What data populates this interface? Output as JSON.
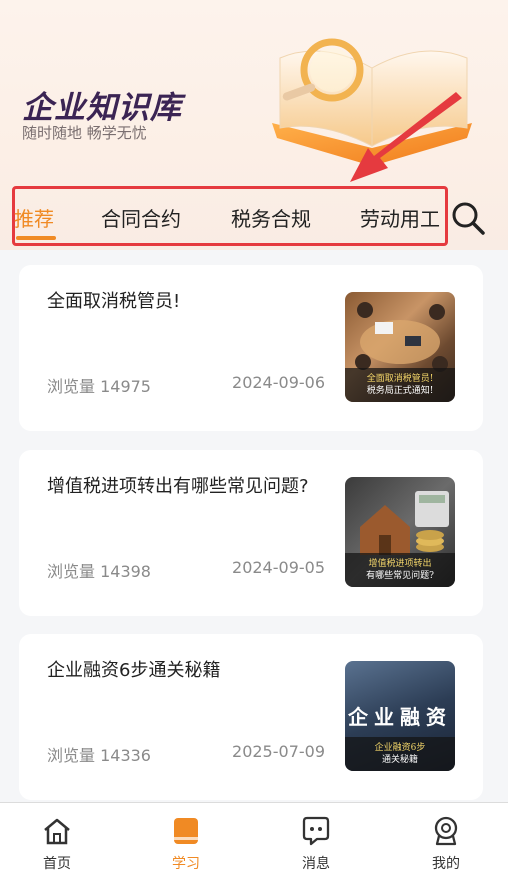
{
  "header": {
    "title": "企业知识库",
    "subtitle": "随时随地   畅学无忧"
  },
  "tabs": [
    {
      "label": "推荐",
      "active": true
    },
    {
      "label": "合同合约",
      "active": false
    },
    {
      "label": "税务合规",
      "active": false
    },
    {
      "label": "劳动用工",
      "active": false
    }
  ],
  "search_icon": "search-icon",
  "articles": [
    {
      "title": "全面取消税管员!",
      "views": "浏览量 14975",
      "date": "2024-09-06",
      "thumb_caption": [
        "全面取消税管员!",
        "税务局正式通知!"
      ]
    },
    {
      "title": "增值税进项转出有哪些常见问题?",
      "views": "浏览量 14398",
      "date": "2024-09-05",
      "thumb_caption": [
        "增值税进项转出",
        "有哪些常见问题?"
      ]
    },
    {
      "title": "企业融资6步通关秘籍",
      "views": "浏览量 14336",
      "date": "2025-07-09",
      "thumb_big": "企业融资",
      "thumb_caption": [
        "企业融资6步",
        "通关秘籍"
      ]
    }
  ],
  "bottom_nav": [
    {
      "label": "首页",
      "icon": "home-icon",
      "active": false
    },
    {
      "label": "学习",
      "icon": "book-icon",
      "active": true
    },
    {
      "label": "消息",
      "icon": "message-icon",
      "active": false
    },
    {
      "label": "我的",
      "icon": "profile-icon",
      "active": false
    }
  ],
  "colors": {
    "accent": "#f08a24",
    "highlight_box": "#e53a3f",
    "title": "#3b2454"
  }
}
